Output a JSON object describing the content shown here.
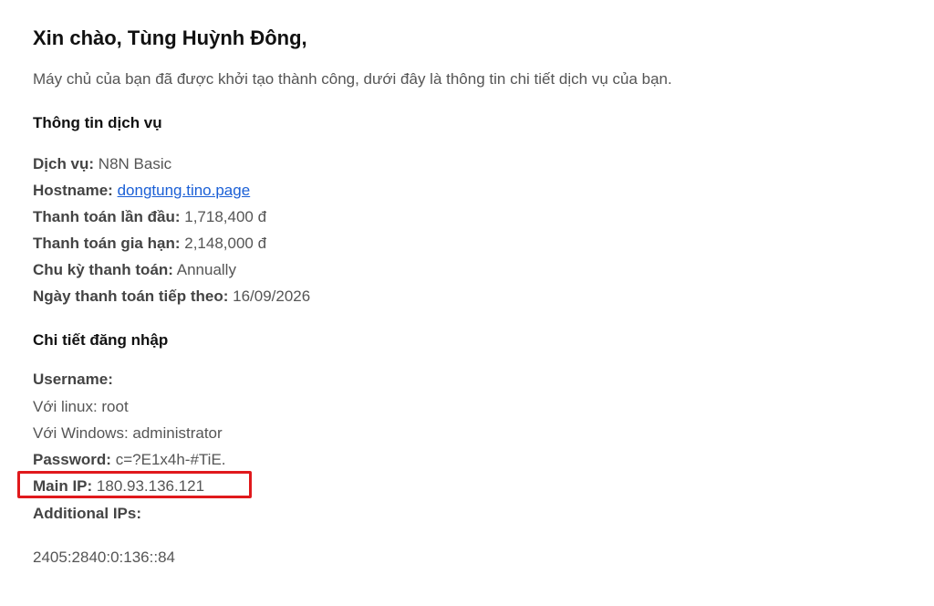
{
  "greeting": "Xin chào, Tùng Huỳnh Đông,",
  "intro": "Máy chủ của bạn đã được khởi tạo thành công, dưới đây là thông tin chi tiết dịch vụ của bạn.",
  "service_info": {
    "title": "Thông tin dịch vụ",
    "service_label": "Dịch vụ:",
    "service_value": "N8N Basic",
    "hostname_label": "Hostname:",
    "hostname_value": "dongtung.tino.page",
    "first_payment_label": "Thanh toán lần đầu:",
    "first_payment_value": "1,718,400 đ",
    "renewal_label": "Thanh toán gia hạn:",
    "renewal_value": "2,148,000 đ",
    "cycle_label": "Chu kỳ thanh toán:",
    "cycle_value": "Annually",
    "next_due_label": "Ngày thanh toán tiếp theo:",
    "next_due_value": "16/09/2026"
  },
  "login_details": {
    "title": "Chi tiết đăng nhập",
    "username_label": "Username:",
    "linux_user": "Với linux: root",
    "windows_user": "Với Windows: administrator",
    "password_label": "Password:",
    "password_value": "c=?E1x4h-#TiE.",
    "main_ip_label": "Main IP:",
    "main_ip_value": "180.93.136.121",
    "additional_ips_label": "Additional IPs:",
    "additional_ip_value": "2405:2840:0:136::84"
  },
  "colors": {
    "link": "#1a5fd6",
    "highlight_border": "#e0191c"
  }
}
